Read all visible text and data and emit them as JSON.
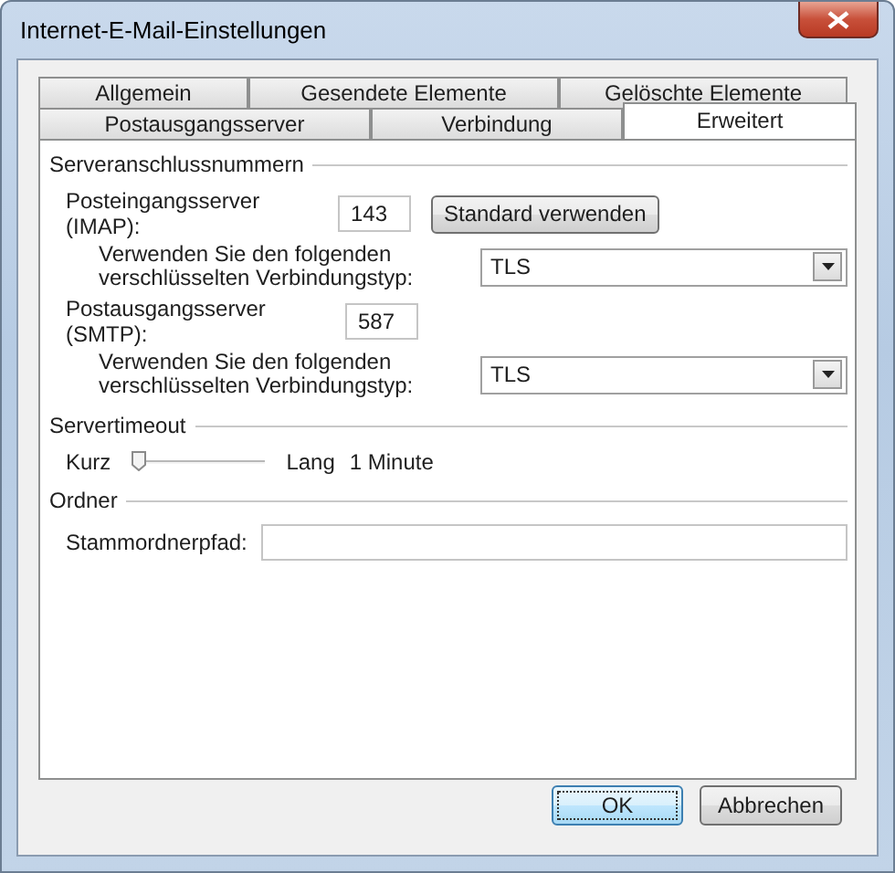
{
  "window": {
    "title": "Internet-E-Mail-Einstellungen"
  },
  "tab_rows": [
    [
      {
        "label": "Allgemein",
        "selected": false
      },
      {
        "label": "Gesendete Elemente",
        "selected": false
      },
      {
        "label": "Gelöschte Elemente",
        "selected": false
      }
    ],
    [
      {
        "label": "Postausgangsserver",
        "selected": false
      },
      {
        "label": "Verbindung",
        "selected": false
      },
      {
        "label": "Erweitert",
        "selected": true
      }
    ]
  ],
  "server_ports": {
    "heading": "Serveranschlussnummern",
    "incoming": {
      "label": "Posteingangsserver (IMAP):",
      "value": "143"
    },
    "default_button": "Standard verwenden",
    "incoming_encryption": {
      "label": "Verwenden Sie den folgenden\nverschlüsselten Verbindungstyp:",
      "value": "TLS"
    },
    "outgoing": {
      "label": "Postausgangsserver (SMTP):",
      "value": "587"
    },
    "outgoing_encryption": {
      "label": "Verwenden Sie den folgenden\nverschlüsselten Verbindungstyp:",
      "value": "TLS"
    }
  },
  "server_timeout": {
    "heading": "Servertimeout",
    "min_label": "Kurz",
    "max_label": "Lang",
    "level": 0.05,
    "reading": "1 Minute"
  },
  "folders": {
    "heading": "Ordner",
    "root_folder": {
      "label": "Stammordnerpfad:"
    }
  },
  "buttons": [
    {
      "label": "OK",
      "default": true
    },
    {
      "label": "Abbrechen",
      "default": false
    }
  ]
}
